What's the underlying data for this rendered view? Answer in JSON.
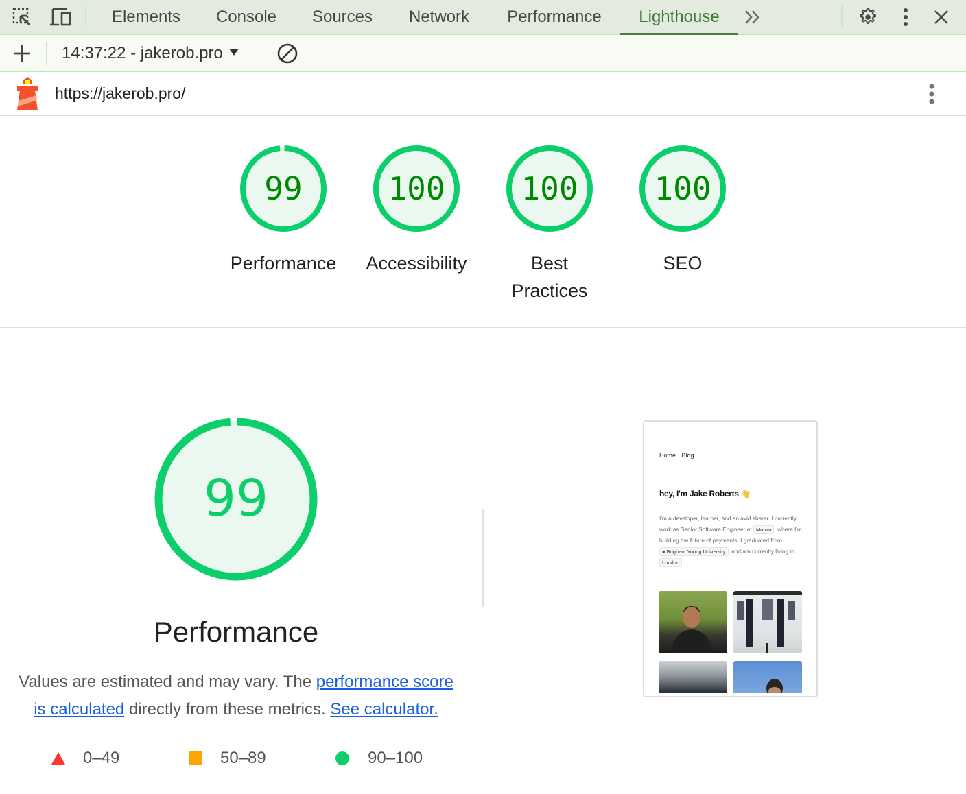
{
  "devtools": {
    "tabs": [
      {
        "label": "Elements",
        "active": false
      },
      {
        "label": "Console",
        "active": false
      },
      {
        "label": "Sources",
        "active": false
      },
      {
        "label": "Network",
        "active": false
      },
      {
        "label": "Performance",
        "active": false
      },
      {
        "label": "Lighthouse",
        "active": true
      }
    ],
    "icons": [
      "inspect-element-icon",
      "device-toolbar-icon",
      "more-tabs-icon",
      "settings-gear-icon",
      "kebab-menu-icon",
      "close-icon"
    ],
    "accent_color": "#3e7a32"
  },
  "lighthouse_toolbar": {
    "report_selector": "14:37:22 - jakerob.pro",
    "icons": [
      "add-icon",
      "dropdown-arrow-icon",
      "clear-icon"
    ]
  },
  "report_header": {
    "url": "https://jakerob.pro/",
    "icons": [
      "lighthouse-logo-icon",
      "report-menu-icon"
    ]
  },
  "categories": [
    {
      "label": "Performance",
      "score": 99
    },
    {
      "label": "Accessibility",
      "score": 100
    },
    {
      "label": "Best Practices",
      "score": 100
    },
    {
      "label": "SEO",
      "score": 100
    }
  ],
  "performance_section": {
    "score": 99,
    "title": "Performance",
    "desc_prefix": "Values are estimated and may vary. The ",
    "link1": "performance score is calculated",
    "desc_middle": " directly from these metrics. ",
    "link2": "See calculator."
  },
  "legend": [
    {
      "shape": "triangle",
      "range": "0–49",
      "color": "#ff3333"
    },
    {
      "shape": "square",
      "range": "50–89",
      "color": "#ffa400"
    },
    {
      "shape": "circle",
      "range": "90–100",
      "color": "#0cce6b"
    }
  ],
  "score_colors": {
    "pass_ring": "#0cce6b",
    "pass_fill": "#eaf8ef",
    "pass_text": "#008800"
  },
  "page_screenshot": {
    "nav": "Home Blog",
    "heading": "hey, I'm Jake Roberts 👋",
    "para_1": "I'm a developer, learner, and an avid sharer. I currently work as Senior Software Engineer at ",
    "chip_1": "Monzo",
    "para_2": ", where I'm building the future of payments. I graduated from ",
    "chip_2": "Brigham Young University",
    "para_3": ", and am currently living in ",
    "chip_3": "London",
    "para_4": "."
  }
}
